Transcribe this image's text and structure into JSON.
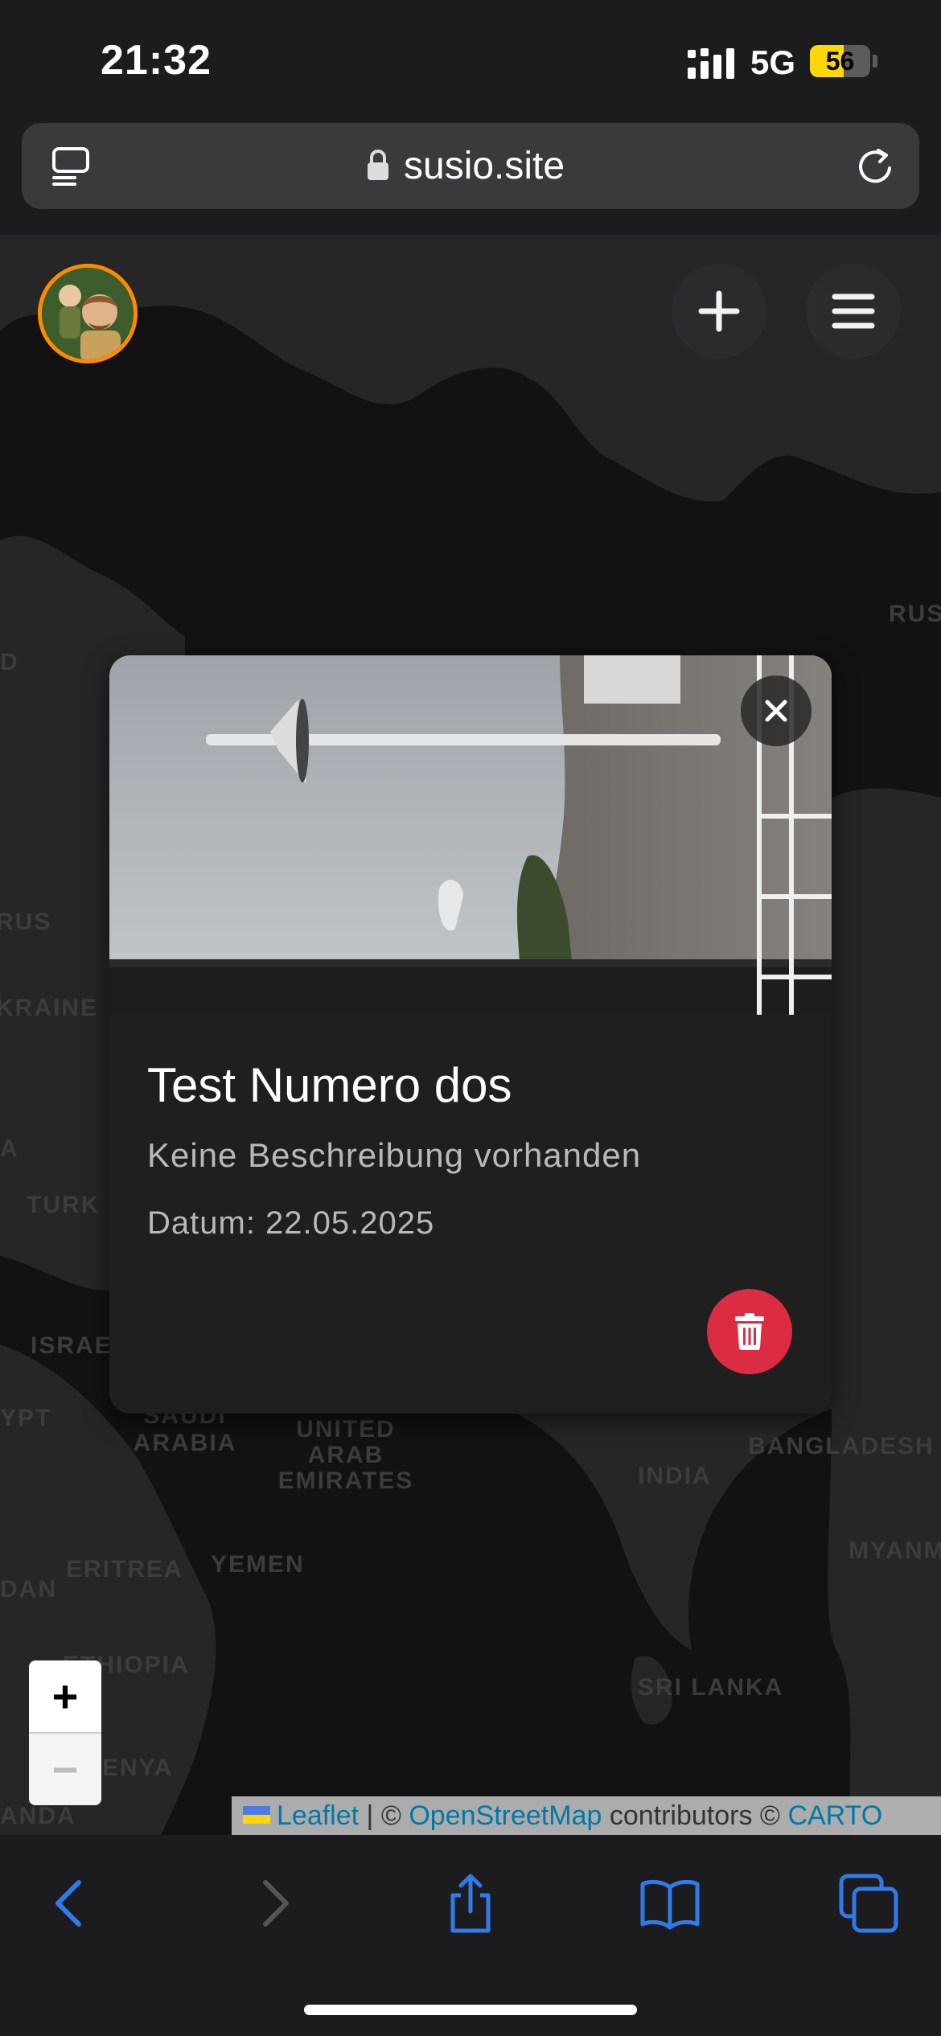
{
  "status_bar": {
    "time": "21:32",
    "network": "5G",
    "battery": "56",
    "battery_level": 0.56
  },
  "browser": {
    "url": "susio.site"
  },
  "map": {
    "labels": [
      {
        "id": "rus-top",
        "text": "RUS"
      },
      {
        "id": "rus-left",
        "text": "RUS"
      },
      {
        "id": "ukraine",
        "text": "KRAINE"
      },
      {
        "id": "turk",
        "text": "TURK"
      },
      {
        "id": "israel",
        "text": "ISRAE"
      },
      {
        "id": "egypt",
        "text": "YPT"
      },
      {
        "id": "saudi",
        "text": "SAUDI ARABIA"
      },
      {
        "id": "uae",
        "text": "UNITED ARAB EMIRATES"
      },
      {
        "id": "india",
        "text": "INDIA"
      },
      {
        "id": "bangladesh",
        "text": "BANGLADESH"
      },
      {
        "id": "myanmar",
        "text": "MYANM"
      },
      {
        "id": "eritrea",
        "text": "ERITREA"
      },
      {
        "id": "yemen",
        "text": "YEMEN"
      },
      {
        "id": "sudan",
        "text": "DAN"
      },
      {
        "id": "ethiopia",
        "text": "ETHIOPIA"
      },
      {
        "id": "srilanka",
        "text": "SRI LANKA"
      },
      {
        "id": "kenya",
        "text": "ENYA"
      },
      {
        "id": "tanzania",
        "text": "ANDA"
      },
      {
        "id": "d-left",
        "text": "D"
      },
      {
        "id": "a-left",
        "text": "A"
      }
    ],
    "zoom_in": "+",
    "zoom_out": "−"
  },
  "popup": {
    "title": "Test Numero dos",
    "description": "Keine Beschreibung vorhanden",
    "date": "Datum: 22.05.2025"
  },
  "attribution": {
    "leaflet": "Leaflet",
    "sep": "|",
    "copy1": "©",
    "osm": "OpenStreetMap",
    "contributors": "contributors ©",
    "carto": "CARTO"
  },
  "colors": {
    "accent_orange": "#ff8a00",
    "delete_red": "#dc2c41",
    "ios_blue": "#2f7bea",
    "link_blue": "#0078a8"
  },
  "icons": [
    "tabs-icon",
    "lock-icon",
    "reload-icon",
    "plus-icon",
    "menu-icon",
    "close-icon",
    "trash-icon",
    "back-icon",
    "forward-icon",
    "share-icon",
    "bookmarks-icon",
    "tabs-overview-icon"
  ]
}
